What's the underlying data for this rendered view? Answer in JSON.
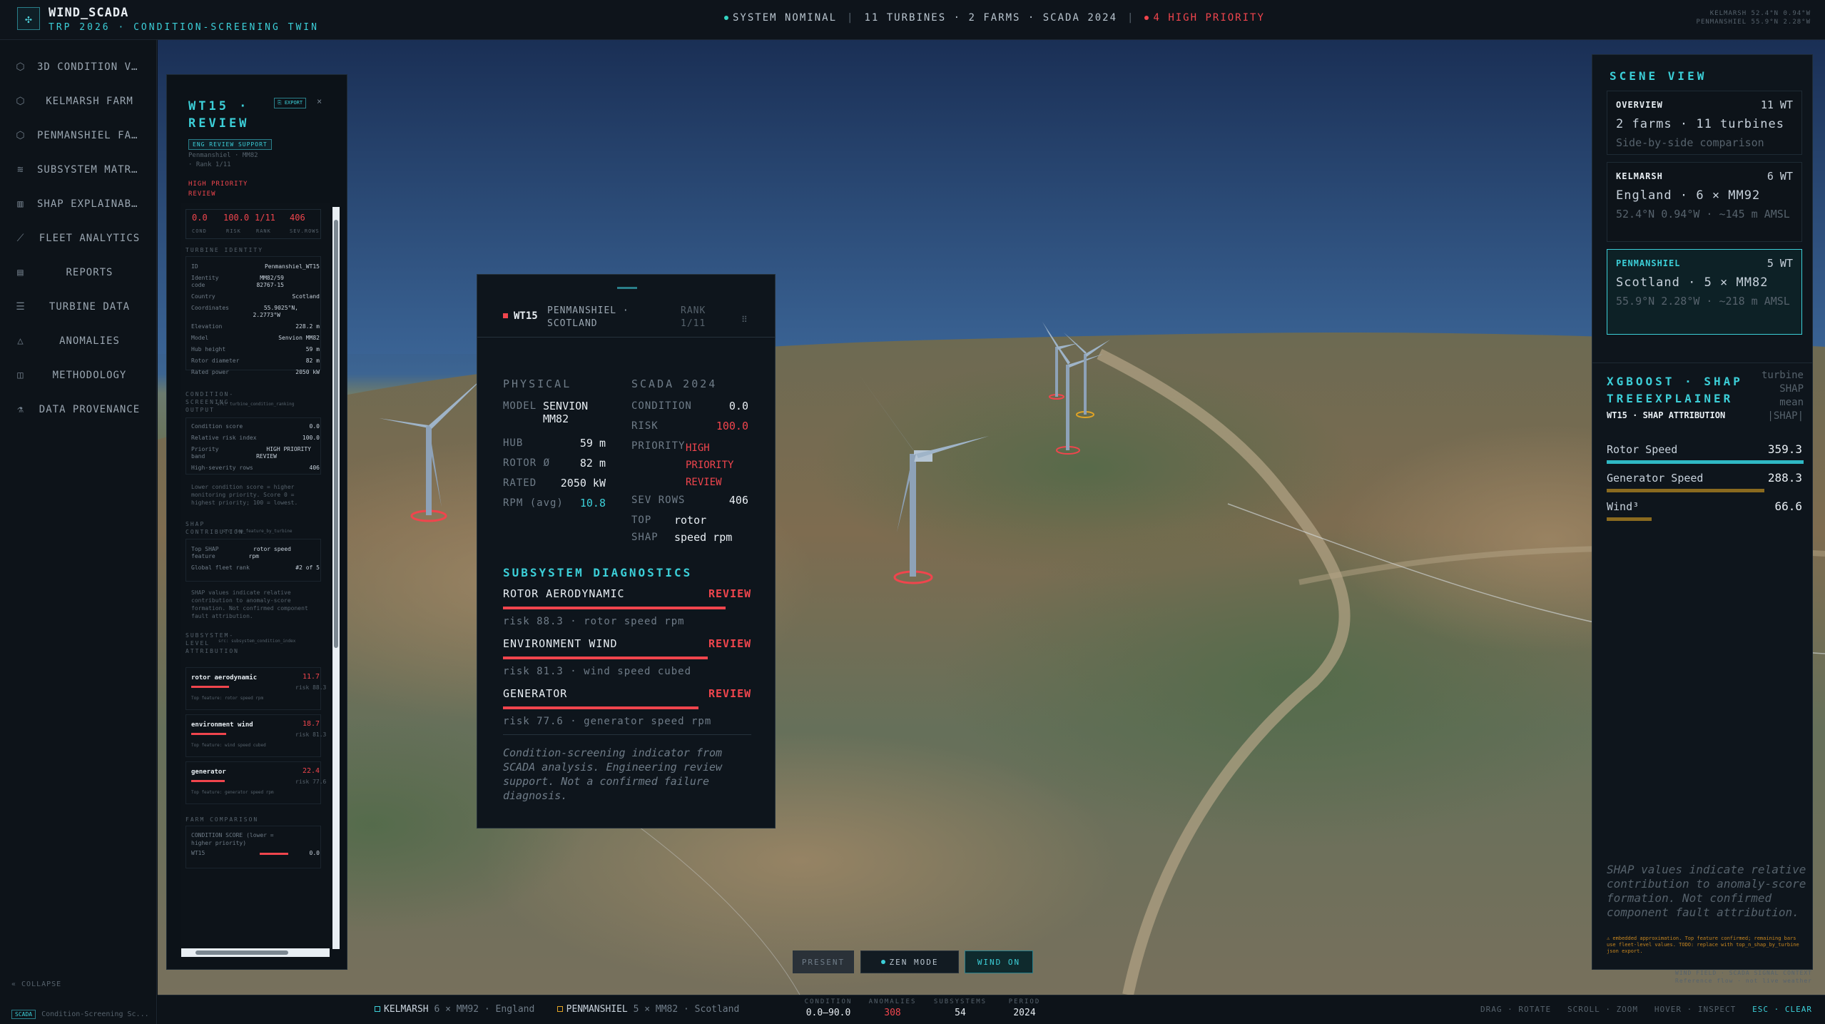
{
  "brand": {
    "name": "WIND_SCADA",
    "subtitle": "TRP 2026 · CONDITION-SCREENING TWIN",
    "logo_icon": "turbine-icon"
  },
  "status": {
    "nominal": "SYSTEM NOMINAL",
    "fleet": "11 TURBINES · 2 FARMS · SCADA 2024",
    "priority": "4 HIGH PRIORITY",
    "coords_1": "KELMARSH 52.4°N 0.94°W",
    "coords_2": "PENMANSHIEL 55.9°N 2.28°W"
  },
  "sidebar": {
    "items": [
      {
        "label": "3D CONDITION VIEW",
        "icon": "cube-icon"
      },
      {
        "label": "KELMARSH FARM",
        "icon": "cube-icon"
      },
      {
        "label": "PENMANSHIEL FARM",
        "icon": "cube-icon"
      },
      {
        "label": "SUBSYSTEM MATRIX",
        "icon": "layers-icon"
      },
      {
        "label": "SHAP EXPLAINABILITY",
        "icon": "bar-chart-icon"
      },
      {
        "label": "FLEET ANALYTICS",
        "icon": "line-chart-icon"
      },
      {
        "label": "REPORTS",
        "icon": "document-icon"
      },
      {
        "label": "TURBINE DATA",
        "icon": "database-icon"
      },
      {
        "label": "ANOMALIES",
        "icon": "warning-icon"
      },
      {
        "label": "METHODOLOGY",
        "icon": "book-icon"
      },
      {
        "label": "DATA PROVENANCE",
        "icon": "flask-icon"
      }
    ],
    "collapse": "« COLLAPSE",
    "footer_tag": "SCADA",
    "footer_text": "Condition-Screening Sc..."
  },
  "review": {
    "title_1": "WT15 ·",
    "title_2": "REVIEW",
    "export": "⎘ EXPORT",
    "close": "×",
    "badge": "ENG REVIEW SUPPORT",
    "meta_1": "Penmanshiel · MM82",
    "meta_2": "· Rank 1/11",
    "priority_1": "HIGH PRIORITY",
    "priority_2": "REVIEW",
    "kpis": [
      {
        "value": "0.0",
        "label": "COND"
      },
      {
        "value": "100.0",
        "label": "RISK"
      },
      {
        "value": "1/11",
        "label": "RANK"
      },
      {
        "value": "406",
        "label": "SEV.ROWS"
      }
    ],
    "identity_head": "TURBINE IDENTITY",
    "identity": [
      {
        "k": "ID",
        "v": "Penmanshiel_WT15"
      },
      {
        "k": "Identity",
        "v": "MM82/59"
      },
      {
        "k": "code",
        "v": "82767-15"
      },
      {
        "k": "Country",
        "v": "Scotland"
      },
      {
        "k": "Coordinates",
        "v": "55.9025°N,"
      },
      {
        "k": "",
        "v": "2.2773°W"
      },
      {
        "k": "Elevation",
        "v": "228.2 m"
      },
      {
        "k": "Model",
        "v": "Senvion MM82"
      },
      {
        "k": "Hub height",
        "v": "59 m"
      },
      {
        "k": "Rotor diameter",
        "v": "82 m"
      },
      {
        "k": "Rated power",
        "v": "2050 kW"
      }
    ],
    "screen_head_1": "CONDITION-",
    "screen_head_2": "SCREENING",
    "screen_head_3": "OUTPUT",
    "screen_src": "src: turbine_condition_ranking",
    "screen": [
      {
        "k": "Condition score",
        "v": "0.0"
      },
      {
        "k": "Relative risk index",
        "v": "100.0"
      },
      {
        "k": "Priority",
        "v": "HIGH PRIORITY"
      },
      {
        "k": "band",
        "v": "REVIEW"
      },
      {
        "k": "High-severity rows",
        "v": "406"
      }
    ],
    "screen_note": "Lower condition score = higher monitoring priority. Score 0 = highest priority; 100 = lowest.",
    "shap_head_1": "SHAP",
    "shap_head_2": "CONTRIBUTION",
    "shap_src": "src: top_feature_by_turbine",
    "shap_rows": [
      {
        "k": "Top SHAP",
        "v": "rotor speed"
      },
      {
        "k": "feature",
        "v": "rpm"
      },
      {
        "k": "Global fleet rank",
        "v": "#2 of 5"
      }
    ],
    "shap_note": "SHAP values indicate relative contribution to anomaly-score formation. Not confirmed component fault attribution.",
    "sub_head_1": "SUBSYSTEM-",
    "sub_head_2": "LEVEL",
    "sub_head_3": "ATTRIBUTION",
    "sub_src": "src: subsystem_condition_index",
    "attribution": [
      {
        "name": "rotor aerodynamic",
        "value": "11.7",
        "risk": "risk 88.3",
        "feature": "Top feature: rotor speed rpm",
        "fraction": 0.883
      },
      {
        "name": "environment wind",
        "value": "18.7",
        "risk": "risk 81.3",
        "feature": "Top feature: wind speed cubed",
        "fraction": 0.813
      },
      {
        "name": "generator",
        "value": "22.4",
        "risk": "risk 77.6",
        "feature": "Top feature: generator speed rpm",
        "fraction": 0.776
      }
    ],
    "farm_head": "FARM COMPARISON",
    "farm_line_1": "CONDITION SCORE (lower =",
    "farm_line_2": "higher priority)",
    "farm_row_name": "WT15",
    "farm_row_value": "0.0"
  },
  "popup": {
    "id": "WT15",
    "loc_1": "PENMANSHIEL ·",
    "loc_2": "SCOTLAND",
    "rank_1": "RANK",
    "rank_2": "1/11",
    "drag_icon": "drag-handle-icon",
    "physical_head": "PHYSICAL",
    "scada_head": "SCADA 2024",
    "physical": [
      {
        "k": "MODEL",
        "v1": "SENVION",
        "v2": "MM82"
      },
      {
        "k": "HUB",
        "v": "59 m"
      },
      {
        "k": "ROTOR Ø",
        "v": "82 m"
      },
      {
        "k": "RATED",
        "v": "2050 kW"
      },
      {
        "k": "RPM (avg)",
        "v": "10.8"
      }
    ],
    "scada": {
      "condition_k": "CONDITION",
      "condition_v": "0.0",
      "risk_k": "RISK",
      "risk_v": "100.0",
      "priority_k": "PRIORITY",
      "priority_v1": "HIGH",
      "priority_v2": "PRIORITY",
      "priority_v3": "REVIEW",
      "sev_k": "SEV ROWS",
      "sev_v": "406",
      "top_k": "TOP",
      "top_v": "rotor",
      "shap_k": "SHAP",
      "shap_v": "speed rpm"
    },
    "subsystem_head": "SUBSYSTEM DIAGNOSTICS",
    "subsystems": [
      {
        "name": "ROTOR AERODYNAMIC",
        "flag": "REVIEW",
        "risk": "risk 88.3 · rotor speed rpm",
        "fraction": 0.883
      },
      {
        "name": "ENVIRONMENT WIND",
        "flag": "REVIEW",
        "risk": "risk 81.3 · wind speed cubed",
        "fraction": 0.813
      },
      {
        "name": "GENERATOR",
        "flag": "REVIEW",
        "risk": "risk 77.6 · generator speed rpm",
        "fraction": 0.776
      }
    ],
    "note": "Condition-screening indicator from SCADA analysis. Engineering review support. Not a confirmed failure diagnosis."
  },
  "scene_view": {
    "title": "SCENE VIEW",
    "cards": [
      {
        "name": "OVERVIEW",
        "count": "11 WT",
        "line1": "2 farms · 11 turbines",
        "line2": "Side-by-side comparison"
      },
      {
        "name": "KELMARSH",
        "count": "6 WT",
        "line1": "England · 6 × MM92",
        "line2": "52.4°N 0.94°W · ~145 m AMSL"
      },
      {
        "name": "PENMANSHIEL",
        "count": "5 WT",
        "line1": "Scotland · 5 × MM82",
        "line2": "55.9°N 2.28°W · ~218 m AMSL"
      }
    ]
  },
  "shap": {
    "title_1": "XGBOOST · SHAP",
    "title_2": "TREEEXPLAINER",
    "meta_1": "turbine",
    "meta_2": "SHAP",
    "meta_3": "mean",
    "meta_4": "|SHAP|",
    "subtitle": "WT15 · SHAP ATTRIBUTION",
    "features": [
      {
        "name": "Rotor Speed",
        "value": "359.3",
        "fraction": 1.0,
        "color": "#2fb8c4"
      },
      {
        "name": "Generator Speed",
        "value": "288.3",
        "fraction": 0.8,
        "color": "#8a6a1f"
      },
      {
        "name": "Wind³",
        "value": "66.6",
        "fraction": 0.23,
        "color": "#8a6a1f"
      }
    ],
    "note": "SHAP values indicate relative contribution to anomaly-score formation. Not confirmed component fault attribution.",
    "warning": "⚠ embedded approximation. Top feature confirmed; remaining bars use fleet-level values. TODO: replace with top_n_shap_by_turbine json export."
  },
  "controls": {
    "present": "PRESENT",
    "zen": "ZEN MODE",
    "wind": "WIND ON"
  },
  "scene_legend": {
    "line1": "WIND FIELD · SCADA SIGNAL CONTEXT",
    "line2": "Reference flow · not live weather"
  },
  "bottom": {
    "farms": [
      {
        "name": "KELMARSH",
        "desc": "6 × MM92 · England",
        "color": "#3ccfd8"
      },
      {
        "name": "PENMANSHIEL",
        "desc": "5 × MM82 · Scotland",
        "color": "#e0a325"
      }
    ],
    "stats": [
      {
        "label": "CONDITION",
        "value": "0.0–90.0",
        "red": false
      },
      {
        "label": "ANOMALIES",
        "value": "308",
        "red": true
      },
      {
        "label": "SUBSYSTEMS",
        "value": "54",
        "red": false
      },
      {
        "label": "PERIOD",
        "value": "2024",
        "red": false
      }
    ],
    "hints": "DRAG · ROTATE   SCROLL · ZOOM   HOVER · INSPECT",
    "hint_key": "ESC · CLEAR"
  }
}
